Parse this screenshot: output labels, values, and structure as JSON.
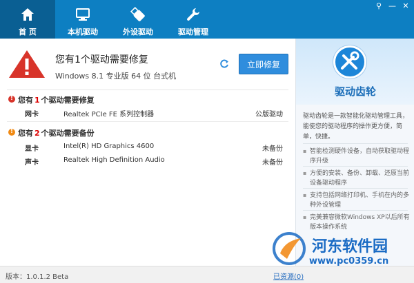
{
  "nav": {
    "tabs": [
      {
        "label": "首 页",
        "icon": "home-icon",
        "active": true
      },
      {
        "label": "本机驱动",
        "icon": "monitor-icon",
        "active": false
      },
      {
        "label": "外设驱动",
        "icon": "usb-icon",
        "active": false
      },
      {
        "label": "驱动管理",
        "icon": "wrench-icon",
        "active": false
      }
    ]
  },
  "window": {
    "pin": "⚲",
    "minimize": "—",
    "close": "✕"
  },
  "status": {
    "headline": "您有1个驱动需要修复",
    "sysinfo": "Windows 8.1 专业版 64 位 台式机",
    "repair_button": "立即修复"
  },
  "repair_section": {
    "prefix": "您有",
    "count": "1",
    "suffix": "个驱动需要修复",
    "items": [
      {
        "type": "网卡",
        "name": "Realtek PCIe FE 系列控制器",
        "status": "公版驱动"
      }
    ]
  },
  "backup_section": {
    "prefix": "您有",
    "count": "2",
    "suffix": "个驱动需要备份",
    "items": [
      {
        "type": "显卡",
        "name": "Intel(R) HD Graphics 4600",
        "status": "未备份"
      },
      {
        "type": "声卡",
        "name": "Realtek High Definition Audio",
        "status": "未备份"
      }
    ]
  },
  "side": {
    "brand": "驱动齿轮",
    "description": "驱动齿轮是一款智能化驱动管理工具，能使您的驱动程序的操作更方便，简单，快捷。",
    "features": [
      "智能检测硬件设备，自动获取驱动程序升级",
      "方便的安装、备份、卸载、还原当前设备驱动程序",
      "支持包括网络打印机、手机在内的多种外设管理",
      "完美兼容微软Windows XP以后所有版本操作系统"
    ]
  },
  "footer": {
    "version": "版本：1.0.1.2 Beta",
    "feedback": "已资源(0)"
  },
  "watermark": {
    "name": "河东软件园",
    "url": "www.pc0359.cn"
  },
  "colors": {
    "topbar": "#0d7fc2",
    "accent": "#2f8ddd",
    "warning_red": "#d8342a",
    "warning_orange": "#f08a14"
  }
}
